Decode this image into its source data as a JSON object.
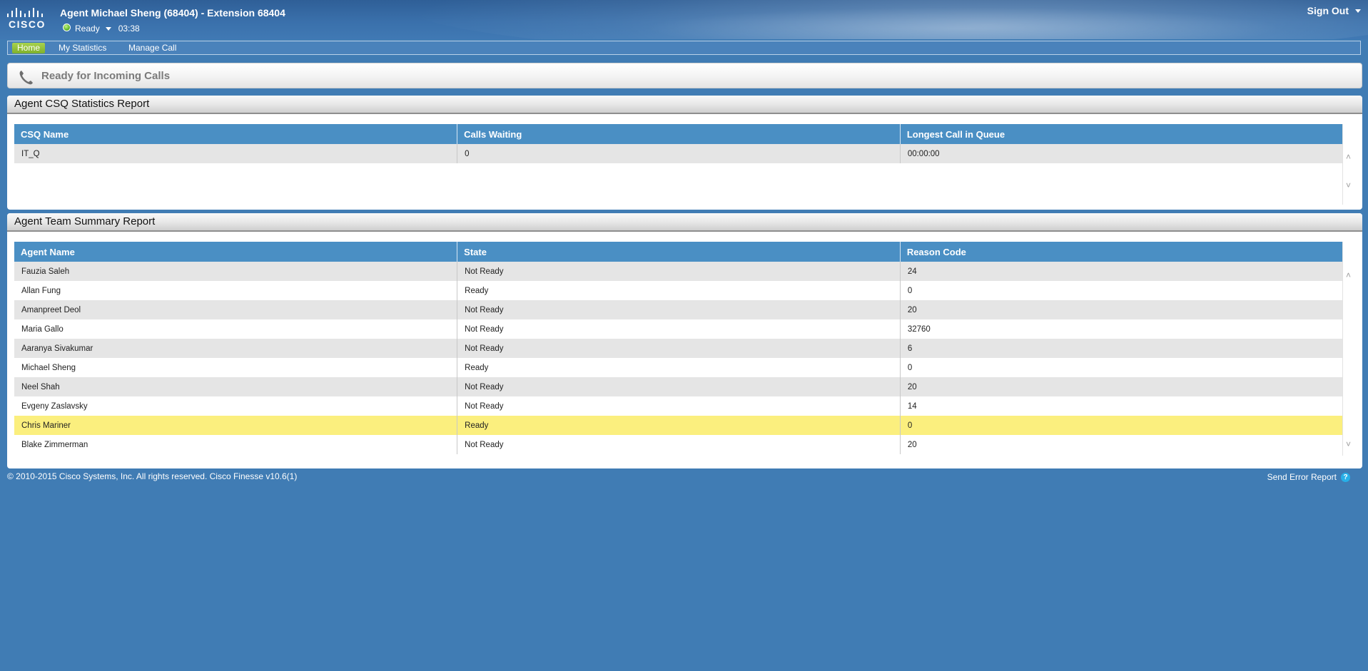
{
  "header": {
    "logo_text": "CISCO",
    "agent_title": "Agent Michael Sheng (68404) - Extension 68404",
    "status_label": "Ready",
    "status_timer": "03:38",
    "signout_label": "Sign Out"
  },
  "nav": {
    "tabs": [
      {
        "label": "Home",
        "active": true
      },
      {
        "label": "My Statistics",
        "active": false
      },
      {
        "label": "Manage Call",
        "active": false
      }
    ]
  },
  "status_panel": {
    "icon": "phone-icon",
    "title": "Ready for Incoming Calls"
  },
  "csq_report": {
    "title": "Agent CSQ Statistics Report",
    "columns": [
      "CSQ Name",
      "Calls Waiting",
      "Longest Call in Queue"
    ],
    "rows": [
      [
        "IT_Q",
        "0",
        "00:00:00"
      ]
    ]
  },
  "team_report": {
    "title": "Agent Team Summary Report",
    "columns": [
      "Agent Name",
      "State",
      "Reason Code"
    ],
    "rows": [
      [
        "Fauzia Saleh",
        "Not Ready",
        "24"
      ],
      [
        "Allan Fung",
        "Ready",
        "0"
      ],
      [
        "Amanpreet Deol",
        "Not Ready",
        "20"
      ],
      [
        "Maria Gallo",
        "Not Ready",
        "32760"
      ],
      [
        "Aaranya Sivakumar",
        "Not Ready",
        "6"
      ],
      [
        "Michael Sheng",
        "Ready",
        "0"
      ],
      [
        "Neel Shah",
        "Not Ready",
        "20"
      ],
      [
        "Evgeny Zaslavsky",
        "Not Ready",
        "14"
      ],
      [
        "Chris Mariner",
        "Ready",
        "0"
      ],
      [
        "Blake Zimmerman",
        "Not Ready",
        "20"
      ]
    ],
    "selected_row": "Chris Mariner"
  },
  "footer": {
    "copyright": "© 2010-2015 Cisco Systems, Inc. All rights reserved. Cisco Finesse v10.6(1)",
    "error_report_label": "Send Error Report",
    "help_icon_glyph": "?"
  },
  "colors": {
    "background": "#407cb4",
    "table_header": "#4a8fc4",
    "active_tab": "#8cc03a",
    "selected_row": "#fbef7e",
    "status_ready": "#5fb82a"
  }
}
